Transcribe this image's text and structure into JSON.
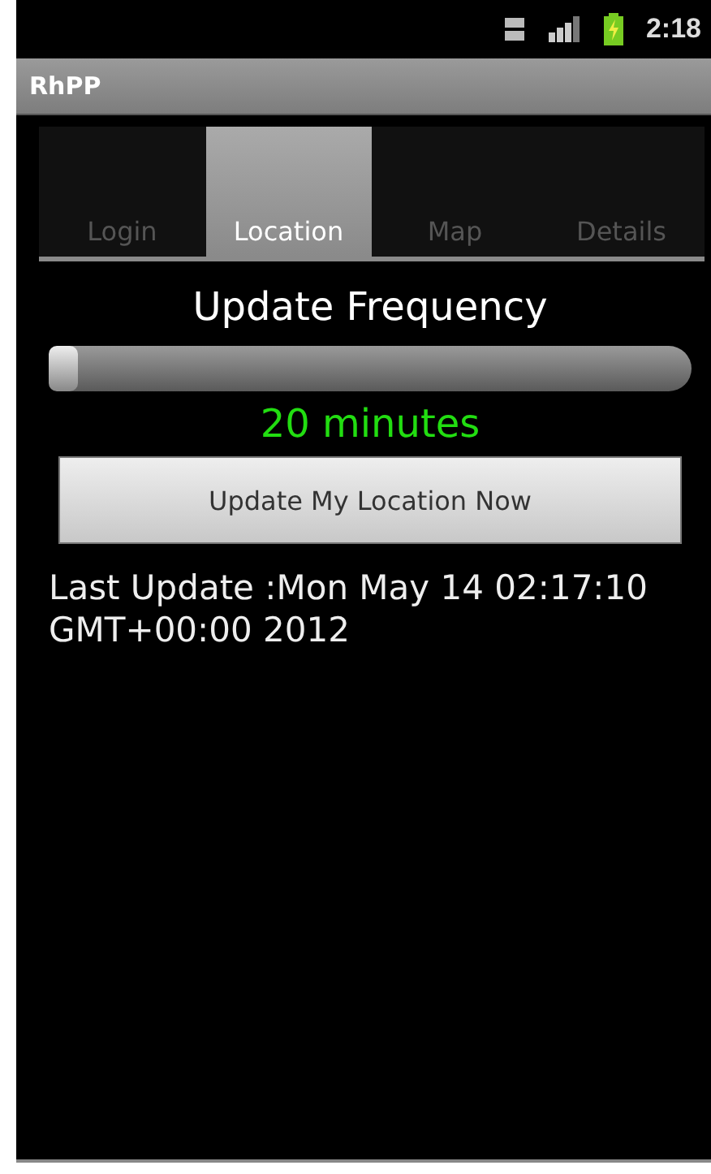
{
  "status_bar": {
    "time": "2:18"
  },
  "app_bar": {
    "title": "RhPP"
  },
  "tabs": [
    {
      "label": "Login",
      "selected": false
    },
    {
      "label": "Location",
      "selected": true
    },
    {
      "label": "Map",
      "selected": false
    },
    {
      "label": "Details",
      "selected": false
    }
  ],
  "frequency": {
    "label": "Update Frequency",
    "level": 0,
    "reading": "20 minutes"
  },
  "update_button": {
    "label": "Update My Location Now"
  },
  "last_update": "Last Update :Mon May 14 02:17:10 GMT+00:00 2012"
}
